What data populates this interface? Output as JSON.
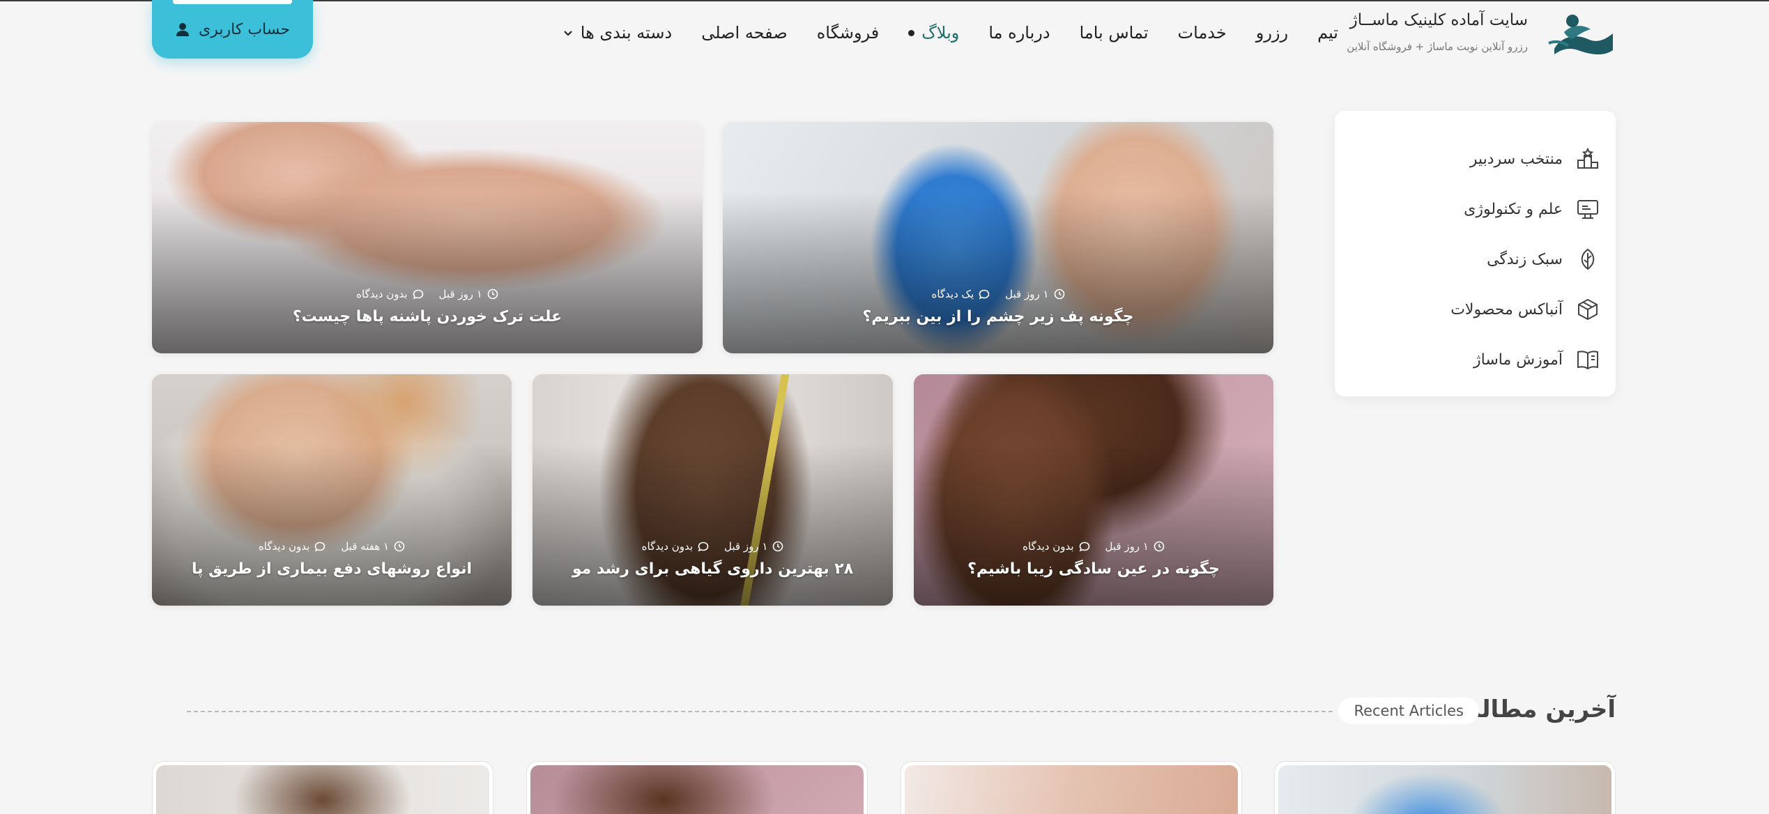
{
  "brand": {
    "title": "سایت آماده کلینیک ماســاژ",
    "subtitle": "رزرو آنلاین نوبت ماساژ + فروشگاه آنلاین"
  },
  "nav": {
    "items": [
      {
        "label": "دسته بندی ها",
        "icon": "chevron-down-icon"
      },
      {
        "label": "صفحه اصلی"
      },
      {
        "label": "فروشگاه"
      },
      {
        "label": "وبلاگ",
        "icon": "dot-icon"
      },
      {
        "label": "درباره ما"
      },
      {
        "label": "تماس باما"
      },
      {
        "label": "خدمات"
      },
      {
        "label": "رزرو"
      },
      {
        "label": "تیم"
      }
    ]
  },
  "account": {
    "label": "حساب کاربری",
    "icon": "user-icon"
  },
  "sidebar": {
    "items": [
      {
        "label": "منتخب سردبیر",
        "icon": "podium-icon"
      },
      {
        "label": "علم و تکنولوژی",
        "icon": "monitor-icon"
      },
      {
        "label": "سبک زندگی",
        "icon": "leaf-icon"
      },
      {
        "label": "آنباکس محصولات",
        "icon": "box-icon"
      },
      {
        "label": "آموزش ماساژ",
        "icon": "book-icon"
      }
    ]
  },
  "posts": [
    {
      "title": "چگونه پف زیر چشم را از بین ببریم؟",
      "time": "۱ روز قبل",
      "comments": "یک دیدگاه"
    },
    {
      "title": "علت ترک خوردن پاشنه پاها چیست؟",
      "time": "۱ روز قبل",
      "comments": "بدون دیدگاه"
    },
    {
      "title": "چگونه در عین سادگی زیبا باشیم؟",
      "time": "۱ روز قبل",
      "comments": "بدون دیدگاه"
    },
    {
      "title": "۲۸ بهترین داروی گیاهی برای رشد مو",
      "time": "۱ روز قبل",
      "comments": "بدون دیدگاه"
    },
    {
      "title": "انواع روشهای دفع بیماری از طریق پا",
      "time": "۱ هفته قبل",
      "comments": "بدون دیدگاه"
    }
  ],
  "recent": {
    "title": "آخرین مطالب",
    "pill": "Recent Articles"
  },
  "colors": {
    "accent": "#3cbfd9",
    "background": "#f5f5f5",
    "brand_dark": "#1f6f6a"
  }
}
